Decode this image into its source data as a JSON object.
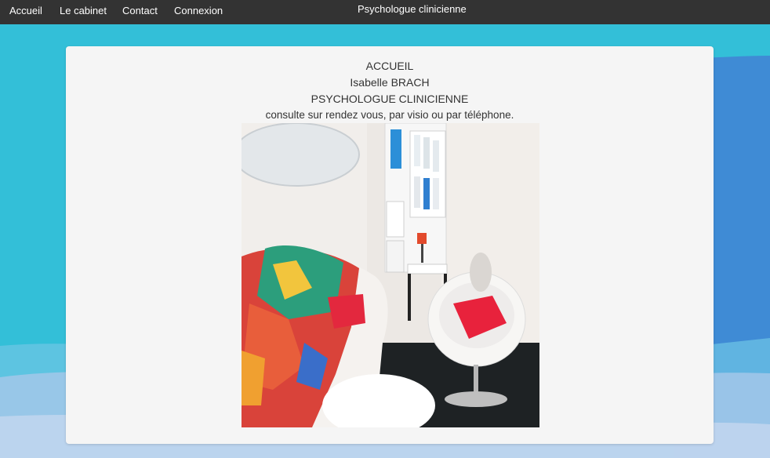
{
  "nav": {
    "items": [
      {
        "label": "Accueil"
      },
      {
        "label": "Le cabinet"
      },
      {
        "label": "Contact"
      },
      {
        "label": "Connexion"
      }
    ],
    "site_title": "Psychologue clinicienne"
  },
  "content": {
    "heading": "ACCUEIL",
    "name": "Isabelle BRACH",
    "profession": "PSYCHOLOGUE CLINICIENNE",
    "info": "consulte sur rendez vous, par visio ou par téléphone."
  },
  "colors": {
    "navbar": "#333333",
    "panel": "#f5f5f5",
    "background_top": "#34bcd9",
    "background_bottom": "#4a7fd2"
  }
}
